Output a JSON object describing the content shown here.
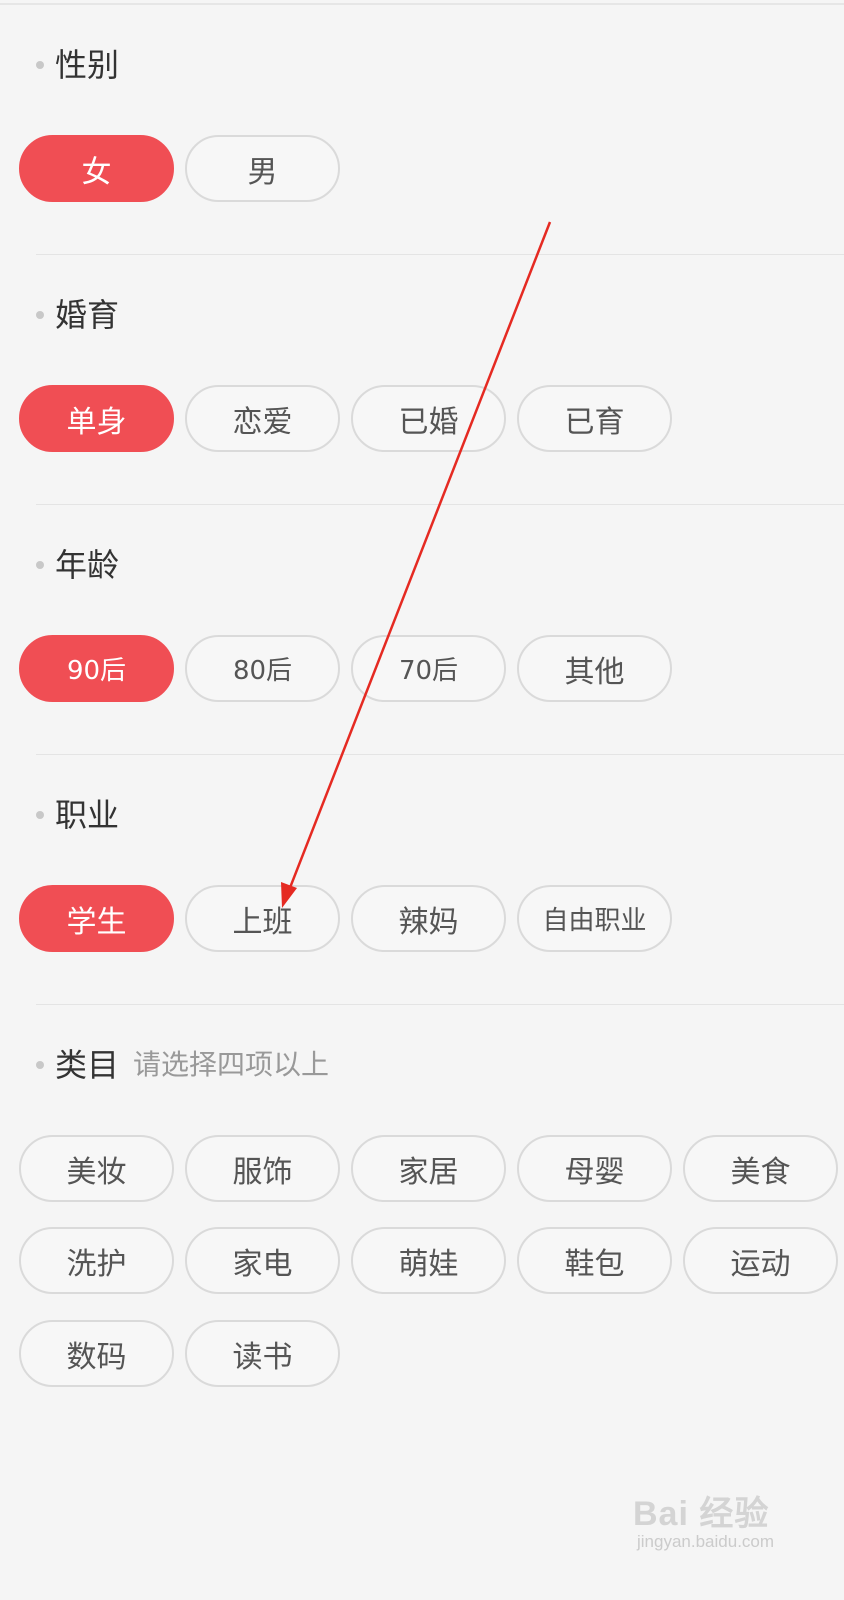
{
  "sections": {
    "gender": {
      "title": "性别",
      "options": [
        "女",
        "男"
      ],
      "selected": "女"
    },
    "marital": {
      "title": "婚育",
      "options": [
        "单身",
        "恋爱",
        "已婚",
        "已育"
      ],
      "selected": "单身"
    },
    "age": {
      "title": "年龄",
      "options": [
        "90后",
        "80后",
        "70后",
        "其他"
      ],
      "selected": "90后"
    },
    "occupation": {
      "title": "职业",
      "options": [
        "学生",
        "上班",
        "辣妈",
        "自由职业"
      ],
      "selected": "学生"
    },
    "category": {
      "title": "类目",
      "hint": "请选择四项以上",
      "options": [
        "美妆",
        "服饰",
        "家居",
        "母婴",
        "美食",
        "洗护",
        "家电",
        "萌娃",
        "鞋包",
        "运动",
        "数码",
        "读书"
      ],
      "selected": []
    }
  },
  "watermark": {
    "brand": "Bai 经验",
    "url": "jingyan.baidu.com"
  },
  "colors": {
    "accent": "#f04e54",
    "annotation_arrow": "#e52a22",
    "background": "#f5f5f5"
  }
}
